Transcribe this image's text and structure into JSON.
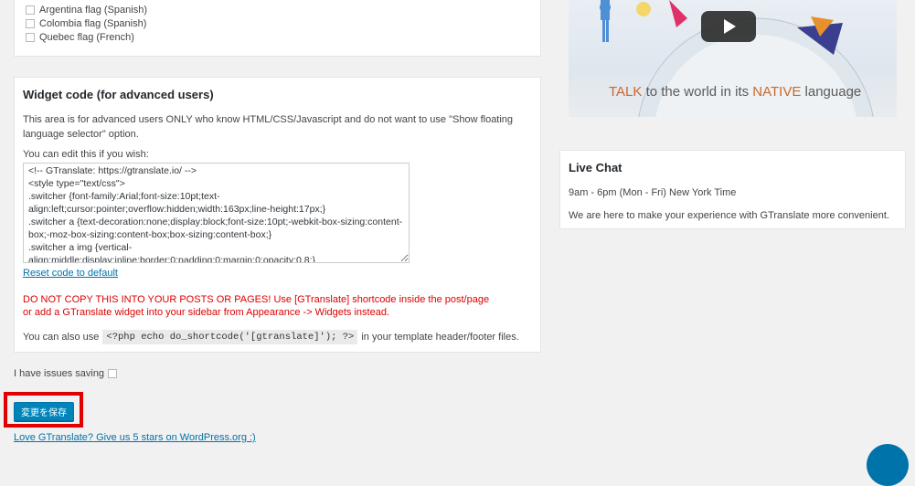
{
  "flags": [
    {
      "label": "Argentina flag (Spanish)"
    },
    {
      "label": "Colombia flag (Spanish)"
    },
    {
      "label": "Quebec flag (French)"
    }
  ],
  "widget_code": {
    "title": "Widget code (for advanced users)",
    "description": "This area is for advanced users ONLY who know HTML/CSS/Javascript and do not want to use \"Show floating language selector\" option.",
    "edit_label": "You can edit this if you wish:",
    "code": "<!-- GTranslate: https://gtranslate.io/ -->\n<style type=\"text/css\">\n.switcher {font-family:Arial;font-size:10pt;text-align:left;cursor:pointer;overflow:hidden;width:163px;line-height:17px;}\n.switcher a {text-decoration:none;display:block;font-size:10pt;-webkit-box-sizing:content-box;-moz-box-sizing:content-box;box-sizing:content-box;}\n.switcher a img {vertical-align:middle;display:inline;border:0;padding:0;margin:0;opacity:0.8;}",
    "reset_link": "Reset code to default",
    "warning_line1": "DO NOT COPY THIS INTO YOUR POSTS OR PAGES! Use [GTranslate] shortcode inside the post/page",
    "warning_line2": "or add a GTranslate widget into your sidebar from Appearance -> Widgets instead.",
    "also_use_prefix": "You can also use",
    "php_snippet": "<?php echo do_shortcode('[gtranslate]'); ?>",
    "also_use_suffix": "in your template header/footer files."
  },
  "issues_saving_label": "I have issues saving",
  "save_button_label": "変更を保存",
  "love_link": "Love GTranslate? Give us 5 stars on WordPress.org :)",
  "video": {
    "tagline_talk": "TALK",
    "tagline_mid": " to the world in its ",
    "tagline_native": "NATIVE",
    "tagline_end": " language"
  },
  "live_chat": {
    "title": "Live Chat",
    "hours": "9am - 6pm (Mon - Fri) New York Time",
    "message": "We are here to make your experience with GTranslate more convenient."
  },
  "colors": {
    "accent": "#0085ba",
    "link": "#0073aa",
    "warning": "#dd0000",
    "highlight": "#e00000"
  }
}
